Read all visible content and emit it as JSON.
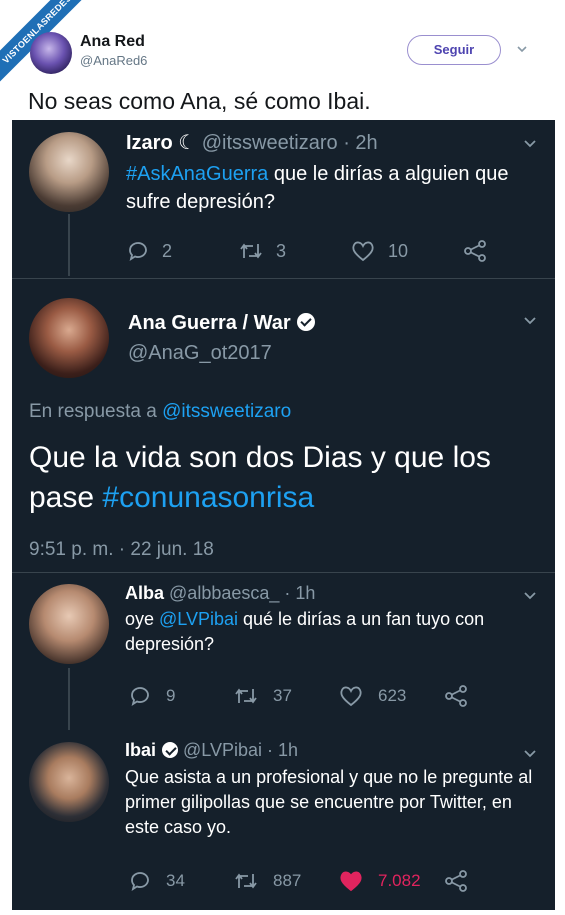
{
  "watermark": "VISTOENLASREDES",
  "outer": {
    "name": "Ana Red",
    "handle": "@AnaRed6",
    "follow_label": "Seguir",
    "text": "No seas como Ana, sé como Ibai."
  },
  "tweet1": {
    "name": "Izaro ☾",
    "handle": "@itssweetizaro · 2h",
    "hashtag": "#AskAnaGuerra",
    "text": " que le dirías a alguien que sufre depresión?",
    "replies": "2",
    "retweets": "3",
    "likes": "10"
  },
  "tweet2": {
    "name": "Ana Guerra / War",
    "handle": "@AnaG_ot2017",
    "reply_prefix": "En respuesta a ",
    "reply_to": "@itssweetizaro",
    "text": "Que la vida son dos Dias y que los pase ",
    "hashtag": "#conunasonrisa",
    "timestamp": "9:51 p. m. · 22 jun. 18"
  },
  "tweet3": {
    "name": "Alba",
    "handle": "@albbaesca_ · 1h",
    "text_before": "oye ",
    "mention": "@LVPibai",
    "text_after": " qué le dirías a un fan tuyo con depresión?",
    "replies": "9",
    "retweets": "37",
    "likes": "623"
  },
  "tweet4": {
    "name": "Ibai",
    "handle": "@LVPibai · 1h",
    "text": "Que asista a un profesional y que no le pregunte al primer gilipollas que se encuentre por Twitter, en este caso yo.",
    "replies": "34",
    "retweets": "887",
    "likes": "7.082"
  },
  "colors": {
    "dark_bg": "#15202b",
    "link": "#1da1f2",
    "muted": "#8899a6",
    "liked": "#e0245e"
  }
}
